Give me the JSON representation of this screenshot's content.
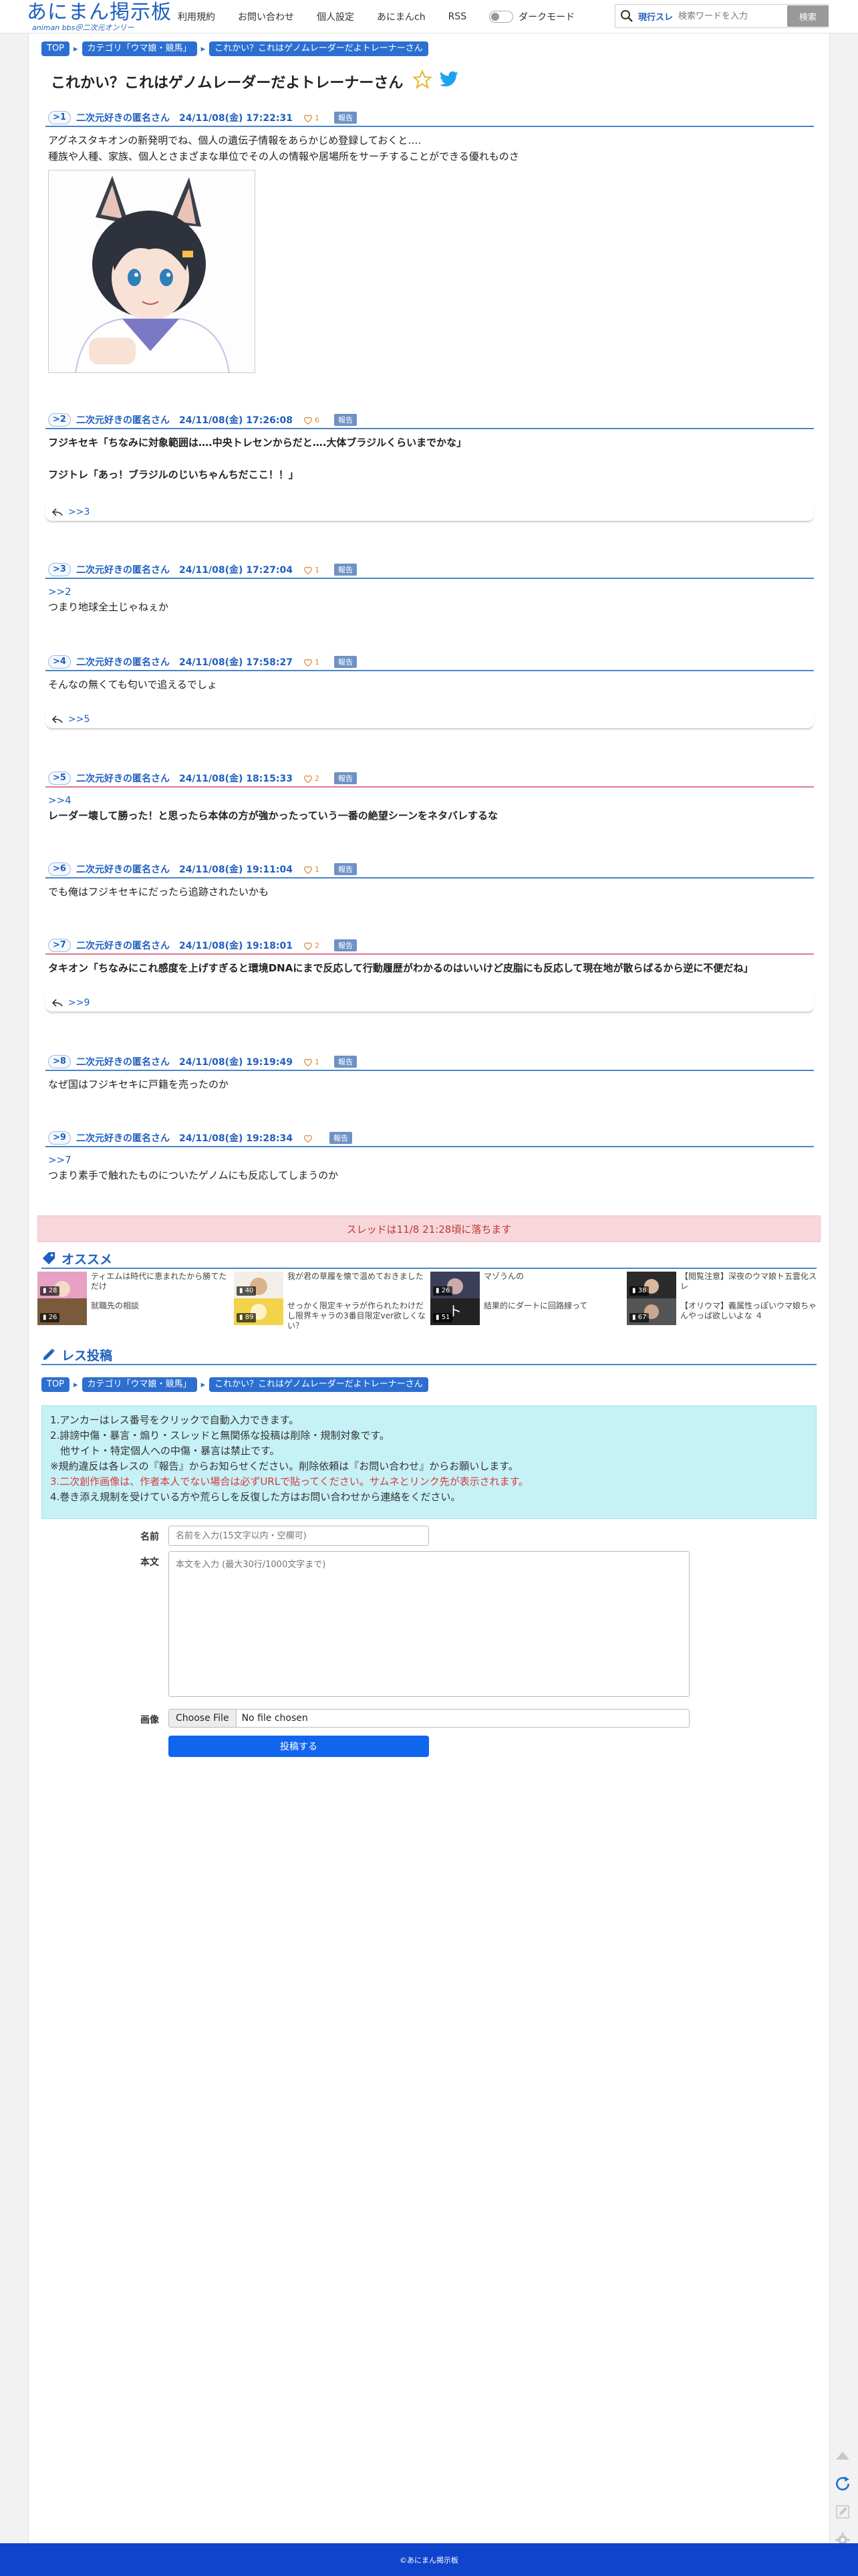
{
  "header": {
    "logo_main": "あにまん掲示板",
    "logo_sub": "animan bbs＠二次元オンリー",
    "nav": [
      "利用規約",
      "お問い合わせ",
      "個人設定",
      "あにまんch",
      "RSS"
    ],
    "dark_mode_label": "ダークモード",
    "search_scope": "現行スレ",
    "search_placeholder": "検索ワードを入力",
    "search_button": "検索"
  },
  "breadcrumb": [
    "TOP",
    "カテゴリ「ウマ娘・競馬」",
    "これかい？これはゲノムレーダーだよトレーナーさん"
  ],
  "thread_title": "これかい？これはゲノムレーダーだよトレーナーさん",
  "report_label": "報告",
  "posts": [
    {
      "num": "1",
      "name": "二次元好きの匿名さん",
      "date": "24/11/08(金) 17:22:31",
      "likes": "1",
      "lines": [
        "アグネスタキオンの新発明でね、個人の遺伝子情報をあらかじめ登録しておくと….",
        "種族や人種、家族、個人とさまざまな単位でその人の情報や居場所をサーチすることができる優れものさ"
      ]
    },
    {
      "num": "2",
      "name": "二次元好きの匿名さん",
      "date": "24/11/08(金) 17:26:08",
      "likes": "6",
      "lines": [
        "フジキセキ「ちなみに対象範囲は….中央トレセンからだと….大体ブラジルくらいまでかな」",
        "",
        "フジトレ「あっ！ブラジルのじいちゃんちだここ！！」"
      ],
      "reply": ">>3"
    },
    {
      "num": "3",
      "name": "二次元好きの匿名さん",
      "date": "24/11/08(金) 17:27:04",
      "likes": "1",
      "anchor": ">>2",
      "lines": [
        "つまり地球全土じゃねぇか"
      ]
    },
    {
      "num": "4",
      "name": "二次元好きの匿名さん",
      "date": "24/11/08(金) 17:58:27",
      "likes": "1",
      "lines": [
        "そんなの無くても匂いで追えるでしょ"
      ],
      "reply": ">>5"
    },
    {
      "num": "5",
      "name": "二次元好きの匿名さん",
      "date": "24/11/08(金) 18:15:33",
      "likes": "2",
      "anchor": ">>4",
      "lines": [
        "レーダー壊して勝った！と思ったら本体の方が強かったっていう一番の絶望シーンをネタバレするな"
      ]
    },
    {
      "num": "6",
      "name": "二次元好きの匿名さん",
      "date": "24/11/08(金) 19:11:04",
      "likes": "1",
      "lines": [
        "でも俺はフジキセキにだったら追跡されたいかも"
      ]
    },
    {
      "num": "7",
      "name": "二次元好きの匿名さん",
      "date": "24/11/08(金) 19:18:01",
      "likes": "2",
      "lines": [
        "タキオン「ちなみにこれ感度を上げすぎると環境DNAにまで反応して行動履歴がわかるのはいいけど皮脂にも反応して現在地が散らばるから逆に不便だね」"
      ],
      "reply": ">>9"
    },
    {
      "num": "8",
      "name": "二次元好きの匿名さん",
      "date": "24/11/08(金) 19:19:49",
      "likes": "1",
      "lines": [
        "なぜ国はフジキセキに戸籍を売ったのか"
      ]
    },
    {
      "num": "9",
      "name": "二次元好きの匿名さん",
      "date": "24/11/08(金) 19:28:34",
      "likes": "",
      "anchor": ">>7",
      "lines": [
        "つまり素手で触れたものについたゲノムにも反応してしまうのか"
      ]
    }
  ],
  "expire_notice": "スレッドは11/8 21:28頃に落ちます",
  "recommend": {
    "title": "オススメ",
    "items": [
      {
        "count": "28",
        "text_top": "ティエムは時代に恵まれたから勝てただけ",
        "text_bottom": "就職先の相談",
        "count2": "26"
      },
      {
        "count": "40",
        "text_top": "我が君の草履を懐で温めておきました",
        "text_bottom": "せっかく限定キャラが作られたわけだし限界キャラの3番目限定ver欲しくない？",
        "count2": "89"
      },
      {
        "count": "26",
        "text_top": "マゾうんの",
        "text_bottom": "結果的にダートに回路線って",
        "count2": "51"
      },
      {
        "count": "38",
        "text_top": "【閲覧注意】深夜のウマ娘ト五雲化スレ",
        "text_bottom": "【オリウマ】義属性っぽいウマ娘ちゃんやっぱ欲しいよな ４",
        "count2": "67"
      }
    ]
  },
  "reply_section_title": "レス投稿",
  "rules": [
    "1.アンカーはレス番号をクリックで自動入力できます。",
    "2.誹謗中傷・暴言・煽り・スレッドと無関係な投稿は削除・規制対象です。",
    "　他サイト・特定個人への中傷・暴言は禁止です。",
    "※規約違反は各レスの『報告』からお知らせください。削除依頼は『お問い合わせ』からお願いします。",
    "3.二次創作画像は、作者本人でない場合は必ずURLで貼ってください。サムネとリンク先が表示されます。",
    "4.巻き添え規制を受けている方や荒らしを反復した方はお問い合わせから連絡をください。"
  ],
  "form": {
    "name_label": "名前",
    "name_placeholder": "名前を入力(15文字以内・空欄可)",
    "body_label": "本文",
    "body_placeholder": "本文を入力 (最大30行/1000文字まで)",
    "image_label": "画像",
    "file_button": "Choose File",
    "file_status": "No file chosen",
    "submit": "投稿する"
  },
  "footer": "©あにまん掲示板",
  "colors": {
    "accent": "#1f5fbf",
    "footer": "#1144cc",
    "rules_bg": "#c6f1f7",
    "expire_bg": "#f7d7db"
  }
}
